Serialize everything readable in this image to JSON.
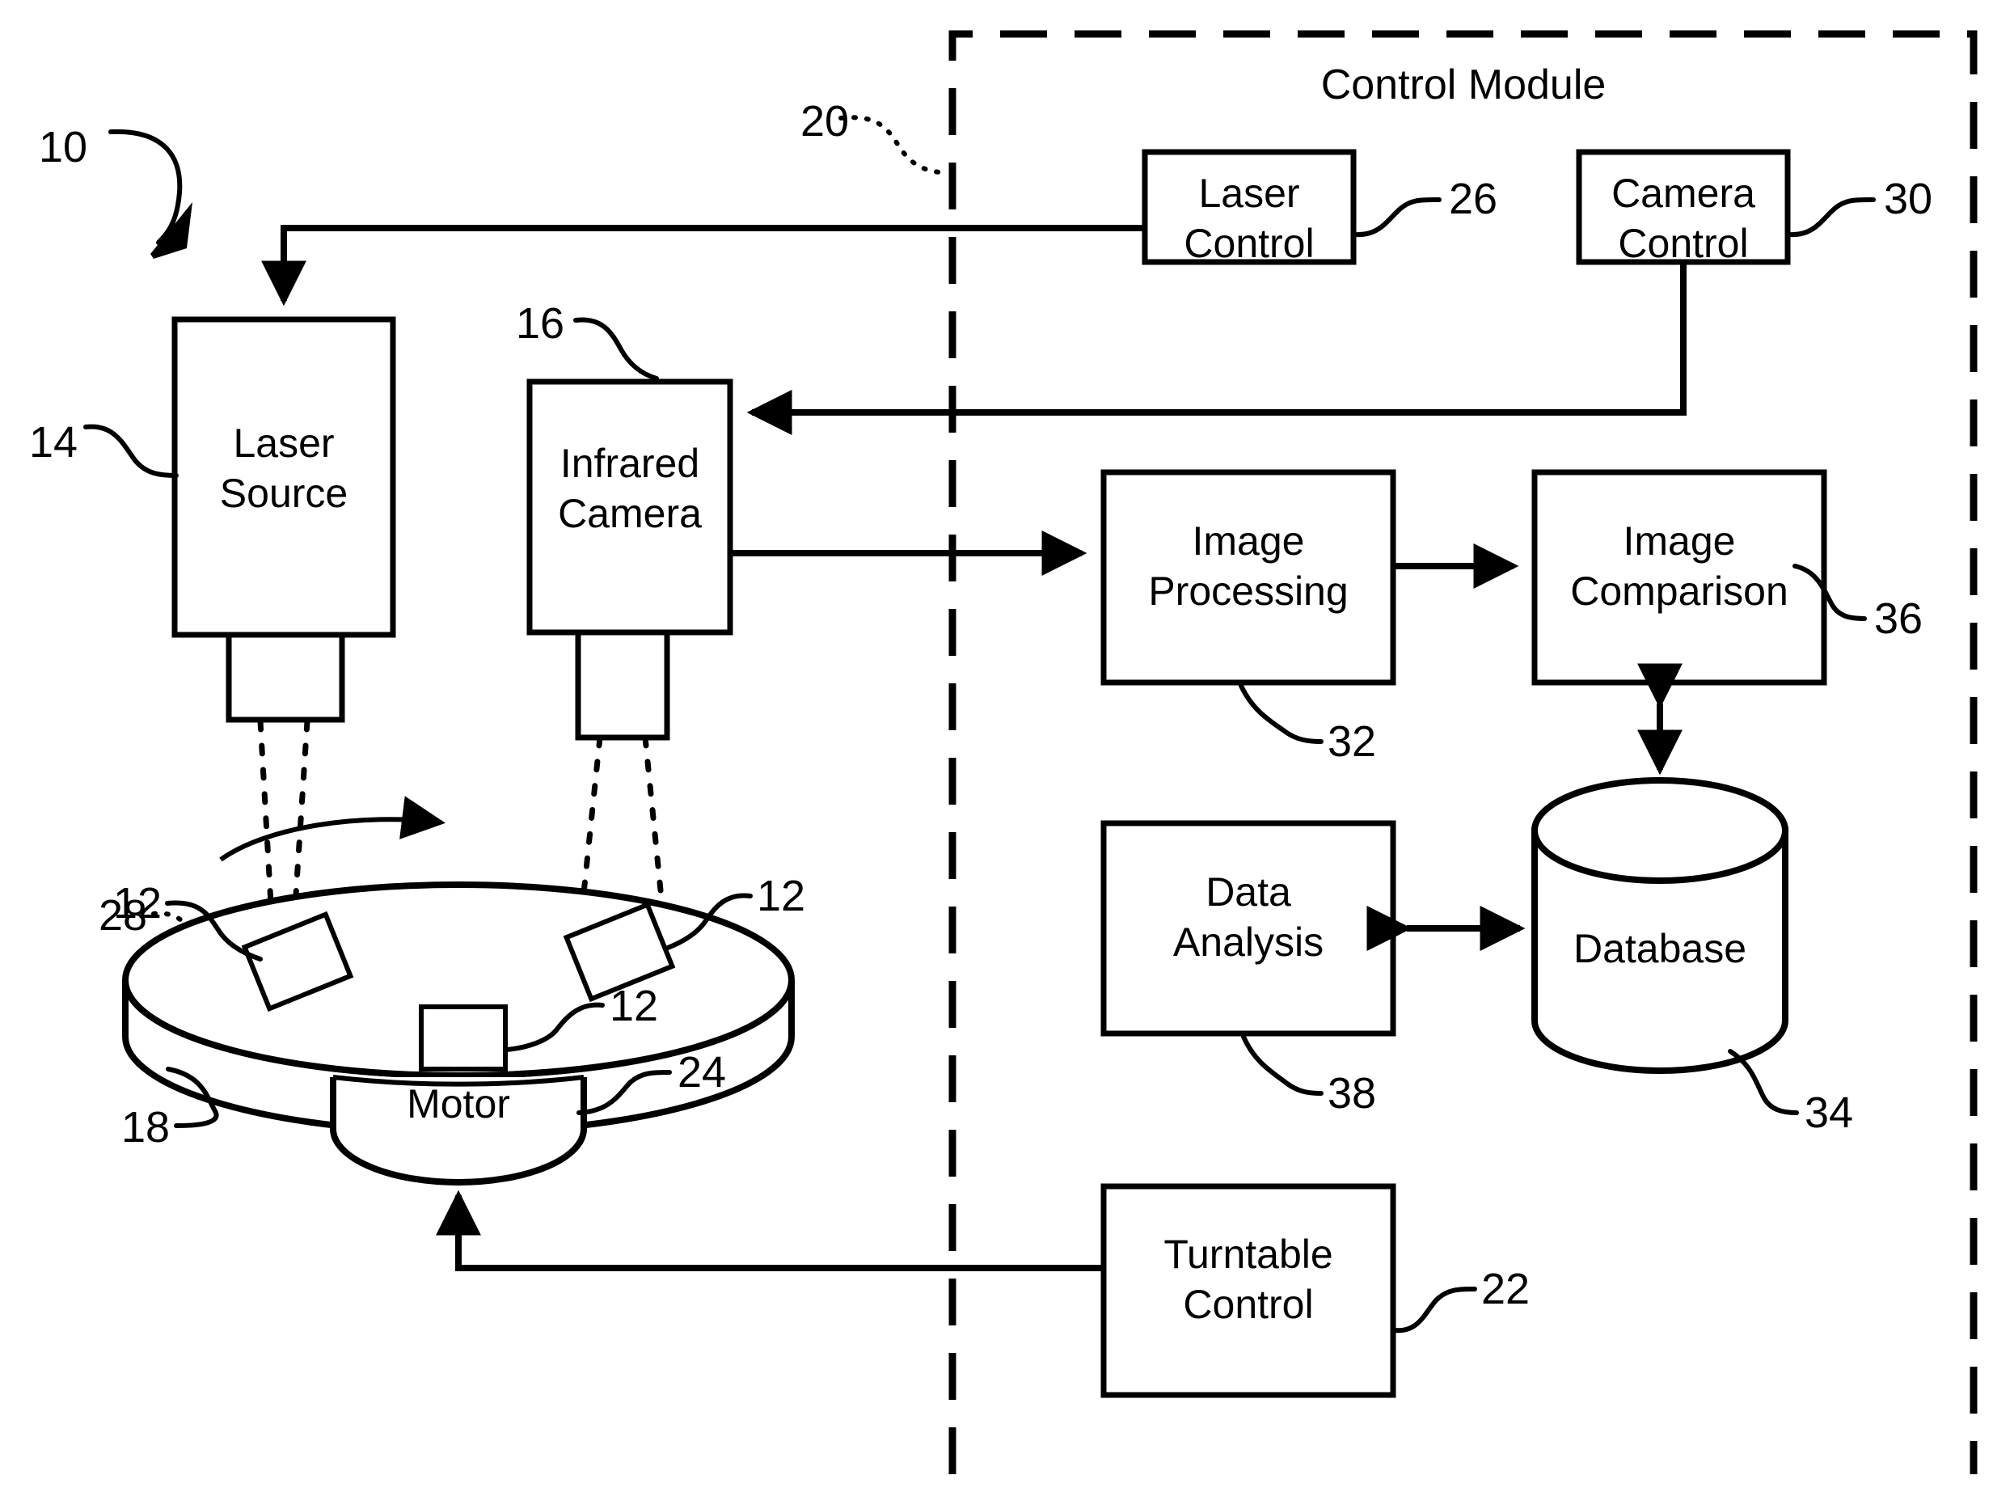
{
  "figure": {
    "title": "Control Module",
    "system_ref": "10"
  },
  "control_module": {
    "label": "Control Module",
    "ref": "20",
    "boxes": [
      {
        "id": "laser-control",
        "line1": "Laser",
        "line2": "Control",
        "ref": "26"
      },
      {
        "id": "camera-control",
        "line1": "Camera",
        "line2": "Control",
        "ref": "30"
      },
      {
        "id": "image-processing",
        "line1": "Image",
        "line2": "Processing",
        "ref": "32"
      },
      {
        "id": "image-comparison",
        "line1": "Image",
        "line2": "Comparison",
        "ref": "36"
      },
      {
        "id": "data-analysis",
        "line1": "Data",
        "line2": "Analysis",
        "ref": "38"
      },
      {
        "id": "turntable-control",
        "line1": "Turntable",
        "line2": "Control",
        "ref": "22"
      }
    ],
    "database": {
      "id": "database",
      "label": "Database",
      "ref": "34"
    }
  },
  "apparatus": {
    "laser_source": {
      "line1": "Laser",
      "line2": "Source",
      "ref": "14"
    },
    "infrared_camera": {
      "line1": "Infrared",
      "line2": "Camera",
      "ref": "16"
    },
    "laser_beam": {
      "ref": "28"
    },
    "turntable": {
      "ref": "18"
    },
    "motor": {
      "label": "Motor",
      "ref": "24"
    },
    "objects": {
      "ref": "12",
      "refs": [
        "12",
        "12",
        "12"
      ]
    }
  },
  "colors": {
    "line": "#000000",
    "background": "#ffffff"
  }
}
